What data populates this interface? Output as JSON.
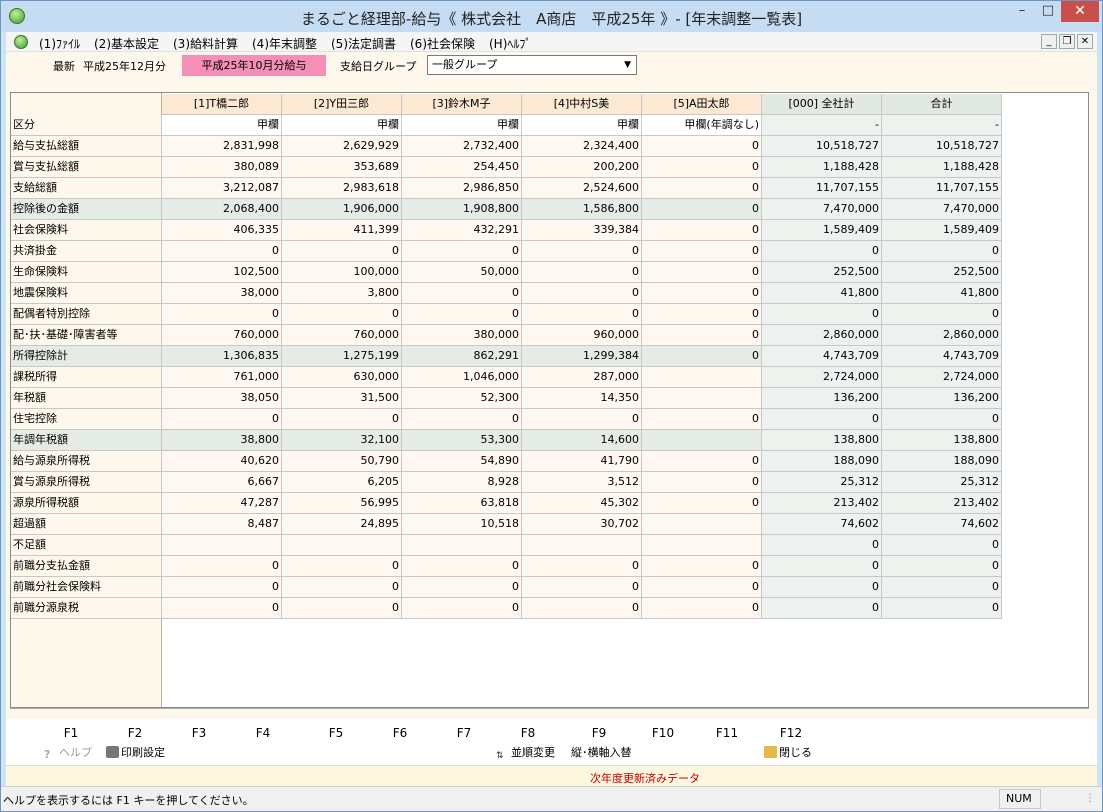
{
  "window": {
    "title": "まるごと経理部-給与《 株式会社　A商店　平成25年 》- [年末調整一覧表]"
  },
  "menu": [
    {
      "label": "(1)ﾌｧｲﾙ"
    },
    {
      "label": "(2)基本設定"
    },
    {
      "label": "(3)給料計算"
    },
    {
      "label": "(4)年末調整"
    },
    {
      "label": "(5)法定調書"
    },
    {
      "label": "(6)社会保険"
    },
    {
      "label": "(H)ﾍﾙﾌﾟ"
    }
  ],
  "toolbar": {
    "latest_label": "最新",
    "latest_value": "平成25年12月分",
    "period_badge": "平成25年10月分給与",
    "group_label": "支給日グループ",
    "group_value": "一般グループ"
  },
  "table": {
    "columns": [
      "[1]T橋二郎",
      "[2]Y田三郎",
      "[3]鈴木M子",
      "[4]中村S美",
      "[5]A田太郎",
      "[000] 全社計",
      "合計"
    ],
    "rows": [
      {
        "label": "区分",
        "values": [
          "甲欄",
          "甲欄",
          "甲欄",
          "甲欄",
          "甲欄(年調なし)",
          "-",
          "-"
        ]
      },
      {
        "label": "給与支払総額",
        "values": [
          "2,831,998",
          "2,629,929",
          "2,732,400",
          "2,324,400",
          "0",
          "10,518,727",
          "10,518,727"
        ]
      },
      {
        "label": "賞与支払総額",
        "values": [
          "380,089",
          "353,689",
          "254,450",
          "200,200",
          "0",
          "1,188,428",
          "1,188,428"
        ]
      },
      {
        "label": "支給総額",
        "values": [
          "3,212,087",
          "2,983,618",
          "2,986,850",
          "2,524,600",
          "0",
          "11,707,155",
          "11,707,155"
        ]
      },
      {
        "label": "控除後の金額",
        "values": [
          "2,068,400",
          "1,906,000",
          "1,908,800",
          "1,586,800",
          "0",
          "7,470,000",
          "7,470,000"
        ]
      },
      {
        "label": "社会保険料",
        "values": [
          "406,335",
          "411,399",
          "432,291",
          "339,384",
          "0",
          "1,589,409",
          "1,589,409"
        ]
      },
      {
        "label": "共済掛金",
        "values": [
          "0",
          "0",
          "0",
          "0",
          "0",
          "0",
          "0"
        ]
      },
      {
        "label": "生命保険料",
        "values": [
          "102,500",
          "100,000",
          "50,000",
          "0",
          "0",
          "252,500",
          "252,500"
        ]
      },
      {
        "label": "地震保険料",
        "values": [
          "38,000",
          "3,800",
          "0",
          "0",
          "0",
          "41,800",
          "41,800"
        ]
      },
      {
        "label": "配偶者特別控除",
        "values": [
          "0",
          "0",
          "0",
          "0",
          "0",
          "0",
          "0"
        ]
      },
      {
        "label": "配･扶･基礎･障害者等",
        "values": [
          "760,000",
          "760,000",
          "380,000",
          "960,000",
          "0",
          "2,860,000",
          "2,860,000"
        ]
      },
      {
        "label": "所得控除計",
        "values": [
          "1,306,835",
          "1,275,199",
          "862,291",
          "1,299,384",
          "0",
          "4,743,709",
          "4,743,709"
        ]
      },
      {
        "label": "課税所得",
        "values": [
          "761,000",
          "630,000",
          "1,046,000",
          "287,000",
          "",
          "2,724,000",
          "2,724,000"
        ]
      },
      {
        "label": "年税額",
        "values": [
          "38,050",
          "31,500",
          "52,300",
          "14,350",
          "",
          "136,200",
          "136,200"
        ]
      },
      {
        "label": "住宅控除",
        "values": [
          "0",
          "0",
          "0",
          "0",
          "0",
          "0",
          "0"
        ]
      },
      {
        "label": "年調年税額",
        "values": [
          "38,800",
          "32,100",
          "53,300",
          "14,600",
          "",
          "138,800",
          "138,800"
        ]
      },
      {
        "label": "給与源泉所得税",
        "values": [
          "40,620",
          "50,790",
          "54,890",
          "41,790",
          "0",
          "188,090",
          "188,090"
        ]
      },
      {
        "label": "賞与源泉所得税",
        "values": [
          "6,667",
          "6,205",
          "8,928",
          "3,512",
          "0",
          "25,312",
          "25,312"
        ]
      },
      {
        "label": "源泉所得税額",
        "values": [
          "47,287",
          "56,995",
          "63,818",
          "45,302",
          "0",
          "213,402",
          "213,402"
        ]
      },
      {
        "label": "超過額",
        "values": [
          "8,487",
          "24,895",
          "10,518",
          "30,702",
          "",
          "74,602",
          "74,602"
        ]
      },
      {
        "label": "不足額",
        "values": [
          "",
          "",
          "",
          "",
          "",
          "0",
          "0"
        ]
      },
      {
        "label": "前職分支払金額",
        "values": [
          "0",
          "0",
          "0",
          "0",
          "0",
          "0",
          "0"
        ]
      },
      {
        "label": "前職分社会保険料",
        "values": [
          "0",
          "0",
          "0",
          "0",
          "0",
          "0",
          "0"
        ]
      },
      {
        "label": "前職分源泉税",
        "values": [
          "0",
          "0",
          "0",
          "0",
          "0",
          "0",
          "0"
        ]
      }
    ]
  },
  "function_keys": [
    "F1",
    "F2",
    "F3",
    "F4",
    "F5",
    "F6",
    "F7",
    "F8",
    "F9",
    "F10",
    "F11",
    "F12"
  ],
  "function_actions": {
    "help": "ヘルプ",
    "print_settings": "印刷設定",
    "sort_change": "並順変更",
    "direction_toggle": "縦･横軸入替",
    "close": "閉じる"
  },
  "notice": "次年度更新済みデータ",
  "status": {
    "message": "ヘルプを表示するには F1 キーを押してください。",
    "num_indicator": "NUM"
  }
}
